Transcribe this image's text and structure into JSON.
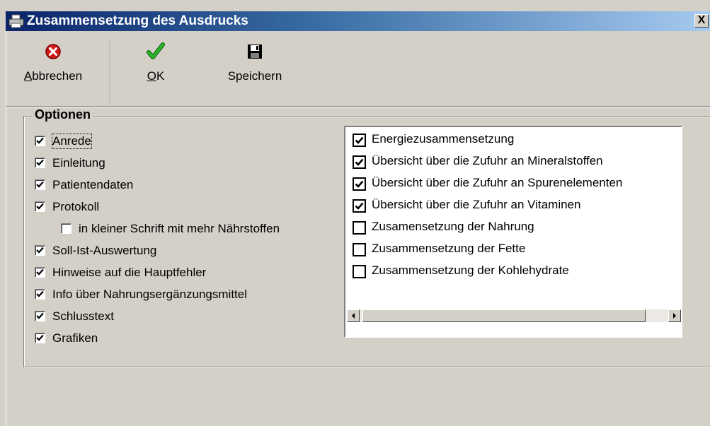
{
  "window": {
    "title": "Zusammensetzung des Ausdrucks",
    "close_symbol": "X"
  },
  "toolbar": {
    "cancel": {
      "label": "Abbrechen",
      "icon": "cancel-icon"
    },
    "ok": {
      "label": "OK",
      "icon": "checkmark-icon"
    },
    "save": {
      "label": "Speichern",
      "icon": "floppy-disk-icon"
    }
  },
  "options": {
    "legend": "Optionen",
    "items": [
      {
        "label": "Anrede",
        "checked": true,
        "focused": true,
        "indent": false
      },
      {
        "label": "Einleitung",
        "checked": true,
        "indent": false
      },
      {
        "label": "Patientendaten",
        "checked": true,
        "indent": false
      },
      {
        "label": "Protokoll",
        "checked": true,
        "indent": false
      },
      {
        "label": "in kleiner Schrift mit mehr Nährstoffen",
        "checked": false,
        "indent": true
      },
      {
        "label": "Soll-Ist-Auswertung",
        "checked": true,
        "indent": false
      },
      {
        "label": "Hinweise auf die Hauptfehler",
        "checked": true,
        "indent": false
      },
      {
        "label": "Info über Nahrungsergänzungsmittel",
        "checked": true,
        "indent": false
      },
      {
        "label": "Schlusstext",
        "checked": true,
        "indent": false
      },
      {
        "label": "Grafiken",
        "checked": true,
        "indent": false
      }
    ]
  },
  "sections": {
    "items": [
      {
        "label": "Energiezusammensetzung",
        "checked": true
      },
      {
        "label": "Übersicht über die Zufuhr an Mineralstoffen",
        "checked": true
      },
      {
        "label": "Übersicht über die Zufuhr an Spurenelementen",
        "checked": true
      },
      {
        "label": "Übersicht über die Zufuhr an Vitaminen",
        "checked": true
      },
      {
        "label": "Zusamensetzung der Nahrung",
        "checked": false
      },
      {
        "label": "Zusammensetzung der Fette",
        "checked": false
      },
      {
        "label": "Zusammensetzung der Kohlehydrate",
        "checked": false
      }
    ]
  },
  "colors": {
    "titlebar_start": "#0a246a",
    "titlebar_end": "#a6caf0",
    "face": "#d4d0c8",
    "ok_green": "#1e9a1e",
    "cancel_red": "#d01818"
  }
}
